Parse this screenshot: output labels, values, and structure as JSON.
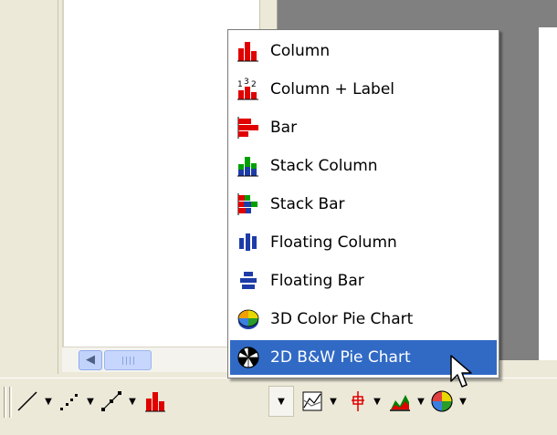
{
  "menu": {
    "items": [
      {
        "label": "Column",
        "icon": "column-chart-icon"
      },
      {
        "label": "Column + Label",
        "icon": "column-label-chart-icon"
      },
      {
        "label": "Bar",
        "icon": "bar-chart-icon"
      },
      {
        "label": "Stack Column",
        "icon": "stack-column-chart-icon"
      },
      {
        "label": "Stack Bar",
        "icon": "stack-bar-chart-icon"
      },
      {
        "label": "Floating Column",
        "icon": "floating-column-chart-icon"
      },
      {
        "label": "Floating Bar",
        "icon": "floating-bar-chart-icon"
      },
      {
        "label": "3D Color Pie Chart",
        "icon": "pie-chart-3d-color-icon"
      },
      {
        "label": "2D B&W Pie Chart",
        "icon": "pie-chart-2d-bw-icon"
      }
    ],
    "selected_index": 8
  },
  "toolbar": {
    "buttons": [
      "line-chart-icon",
      "scatter-chart-icon",
      "line-points-chart-icon",
      "column-chart-icon",
      "area-chart-icon",
      "hi-lo-chart-icon",
      "mountain-chart-icon",
      "pie-chart-icon"
    ]
  },
  "colors": {
    "selection": "#316ac5",
    "background": "#ece9d8",
    "chart_red": "#e00000",
    "chart_blue": "#1e3ca8"
  }
}
